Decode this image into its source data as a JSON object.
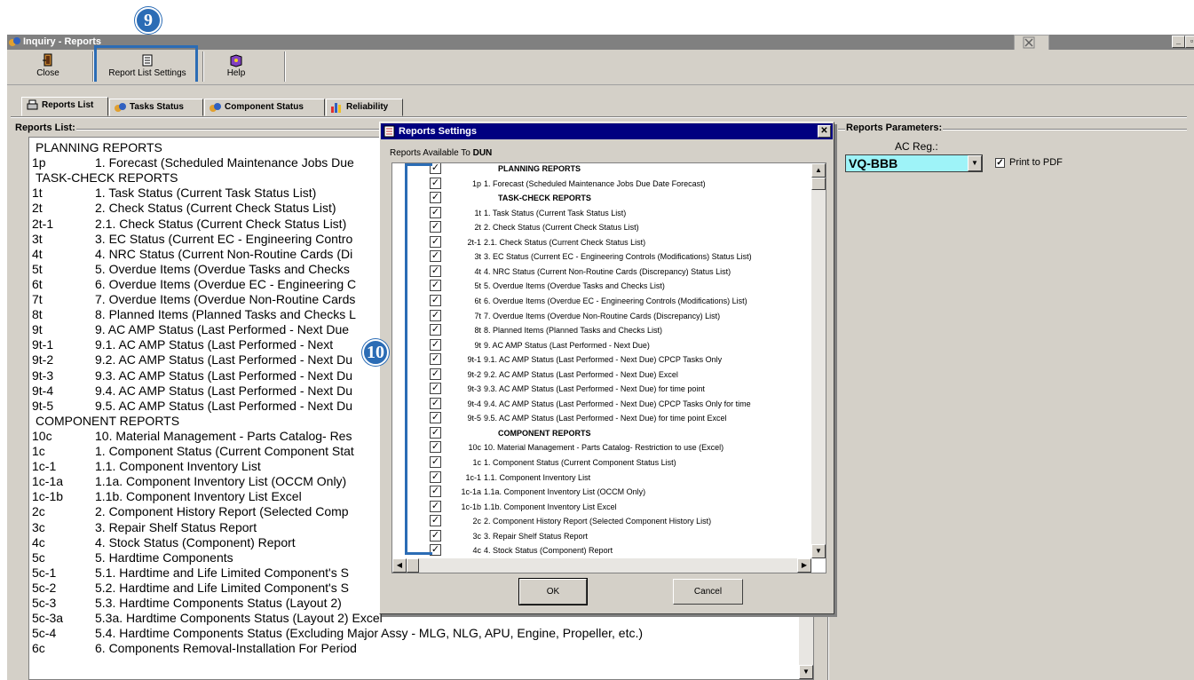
{
  "window": {
    "title": "Inquiry - Reports"
  },
  "toolbar": {
    "close_label": "Close",
    "settings_label": "Report List Settings",
    "help_label": "Help"
  },
  "tabs": [
    {
      "label": "Reports List"
    },
    {
      "label": "Tasks Status"
    },
    {
      "label": "Component Status"
    },
    {
      "label": "Reliability"
    }
  ],
  "reports_list": {
    "label": "Reports List:",
    "rows": [
      {
        "code": "",
        "name": "PLANNING REPORTS",
        "header": true
      },
      {
        "code": "1p",
        "name": "1. Forecast (Scheduled Maintenance Jobs Due"
      },
      {
        "code": "",
        "name": "TASK-CHECK REPORTS",
        "header": true
      },
      {
        "code": "1t",
        "name": "1. Task Status (Current Task Status List)"
      },
      {
        "code": "2t",
        "name": "2. Check Status (Current Check Status List)"
      },
      {
        "code": "2t-1",
        "name": "2.1. Check Status (Current Check Status List)"
      },
      {
        "code": "3t",
        "name": "3. EC Status (Current EC - Engineering Contro"
      },
      {
        "code": "4t",
        "name": "4. NRC Status (Current Non-Routine Cards (Di"
      },
      {
        "code": "5t",
        "name": "5. Overdue Items (Overdue Tasks and Checks"
      },
      {
        "code": "6t",
        "name": "6. Overdue Items (Overdue EC - Engineering C"
      },
      {
        "code": "7t",
        "name": "7. Overdue Items (Overdue Non-Routine Cards"
      },
      {
        "code": "8t",
        "name": "8. Planned Items (Planned Tasks and Checks L"
      },
      {
        "code": "9t",
        "name": "9. AC AMP Status (Last Performed - Next Due"
      },
      {
        "code": "9t-1",
        "name": "9.1. AC AMP Status (Last Performed - Next"
      },
      {
        "code": "9t-2",
        "name": "9.2. AC AMP Status (Last Performed - Next Du"
      },
      {
        "code": "9t-3",
        "name": "9.3. AC AMP Status (Last Performed - Next Du"
      },
      {
        "code": "9t-4",
        "name": "9.4. AC AMP Status (Last Performed - Next Du"
      },
      {
        "code": "9t-5",
        "name": "9.5. AC AMP Status (Last Performed - Next Du"
      },
      {
        "code": "",
        "name": "COMPONENT REPORTS",
        "header": true
      },
      {
        "code": "10c",
        "name": "10. Material Management - Parts Catalog- Res"
      },
      {
        "code": "1c",
        "name": "1. Component Status (Current Component Stat"
      },
      {
        "code": "1c-1",
        "name": "1.1. Component Inventory List"
      },
      {
        "code": "1c-1a",
        "name": "1.1a. Component Inventory List (OCCM Only)"
      },
      {
        "code": "1c-1b",
        "name": "1.1b. Component Inventory List Excel"
      },
      {
        "code": "2c",
        "name": "2. Component History Report (Selected Comp"
      },
      {
        "code": "3c",
        "name": "3. Repair Shelf Status Report"
      },
      {
        "code": "4c",
        "name": "4. Stock Status (Component) Report"
      },
      {
        "code": "5c",
        "name": "5. Hardtime Components"
      },
      {
        "code": "5c-1",
        "name": "5.1. Hardtime and Life Limited Component's S"
      },
      {
        "code": "5c-2",
        "name": "5.2. Hardtime and Life Limited Component's S"
      },
      {
        "code": "5c-3",
        "name": "5.3. Hardtime Components Status (Layout 2)"
      },
      {
        "code": "5c-3a",
        "name": "5.3a. Hardtime Components Status (Layout 2) Excel"
      },
      {
        "code": "5c-4",
        "name": "5.4. Hardtime Components Status (Excluding Major Assy - MLG, NLG, APU, Engine, Propeller, etc.)"
      },
      {
        "code": "6c",
        "name": "6. Components Removal-Installation For Period"
      }
    ]
  },
  "parameters": {
    "label": "Reports Parameters:",
    "ac_reg_label": "AC Reg.:",
    "ac_reg_value": "VQ-BBB",
    "print_pdf_label": "Print to PDF",
    "print_pdf_checked": true
  },
  "dialog": {
    "title": "Reports Settings",
    "available_prefix": "Reports Available To",
    "available_user": "DUN",
    "ok_label": "OK",
    "cancel_label": "Cancel",
    "rows": [
      {
        "code": "",
        "name": "PLANNING REPORTS",
        "header": true
      },
      {
        "code": "1p",
        "name": "1. Forecast (Scheduled Maintenance Jobs Due Date Forecast)"
      },
      {
        "code": "",
        "name": "TASK-CHECK REPORTS",
        "header": true
      },
      {
        "code": "1t",
        "name": "1. Task Status (Current Task Status List)"
      },
      {
        "code": "2t",
        "name": "2. Check Status (Current Check Status List)"
      },
      {
        "code": "2t-1",
        "name": "2.1. Check Status (Current Check Status List)"
      },
      {
        "code": "3t",
        "name": "3. EC Status (Current EC - Engineering Controls (Modifications) Status List)"
      },
      {
        "code": "4t",
        "name": "4. NRC Status (Current Non-Routine Cards (Discrepancy) Status List)"
      },
      {
        "code": "5t",
        "name": "5. Overdue Items (Overdue Tasks and Checks List)"
      },
      {
        "code": "6t",
        "name": "6. Overdue Items (Overdue EC - Engineering Controls (Modifications) List)"
      },
      {
        "code": "7t",
        "name": "7. Overdue Items (Overdue Non-Routine Cards (Discrepancy) List)"
      },
      {
        "code": "8t",
        "name": "8. Planned Items (Planned Tasks and Checks List)"
      },
      {
        "code": "9t",
        "name": "9. AC AMP Status (Last Performed - Next Due)"
      },
      {
        "code": "9t-1",
        "name": "9.1. AC AMP Status (Last Performed - Next Due) CPCP Tasks Only"
      },
      {
        "code": "9t-2",
        "name": "9.2. AC AMP Status (Last Performed - Next Due) Excel"
      },
      {
        "code": "9t-3",
        "name": "9.3. AC AMP Status (Last Performed - Next Due) for time point"
      },
      {
        "code": "9t-4",
        "name": "9.4. AC AMP Status (Last Performed - Next Due) CPCP Tasks Only for time"
      },
      {
        "code": "9t-5",
        "name": "9.5. AC AMP Status (Last Performed - Next Due) for time point Excel"
      },
      {
        "code": "",
        "name": "COMPONENT REPORTS",
        "header": true
      },
      {
        "code": "10c",
        "name": "10. Material Management - Parts Catalog- Restriction to use (Excel)"
      },
      {
        "code": "1c",
        "name": "1. Component Status (Current Component Status List)"
      },
      {
        "code": "1c-1",
        "name": "1.1. Component Inventory List"
      },
      {
        "code": "1c-1a",
        "name": "1.1a. Component Inventory List (OCCM Only)"
      },
      {
        "code": "1c-1b",
        "name": "1.1b. Component Inventory List Excel"
      },
      {
        "code": "2c",
        "name": "2. Component History Report (Selected Component History List)"
      },
      {
        "code": "3c",
        "name": "3. Repair Shelf Status Report"
      },
      {
        "code": "4c",
        "name": "4. Stock Status (Component) Report"
      }
    ]
  },
  "callouts": {
    "settings": "9",
    "checkboxes": "10"
  },
  "colors": {
    "dialog_title": "#000080",
    "callout": "#2b6cb5",
    "combo_bg": "#9ef3f8"
  }
}
